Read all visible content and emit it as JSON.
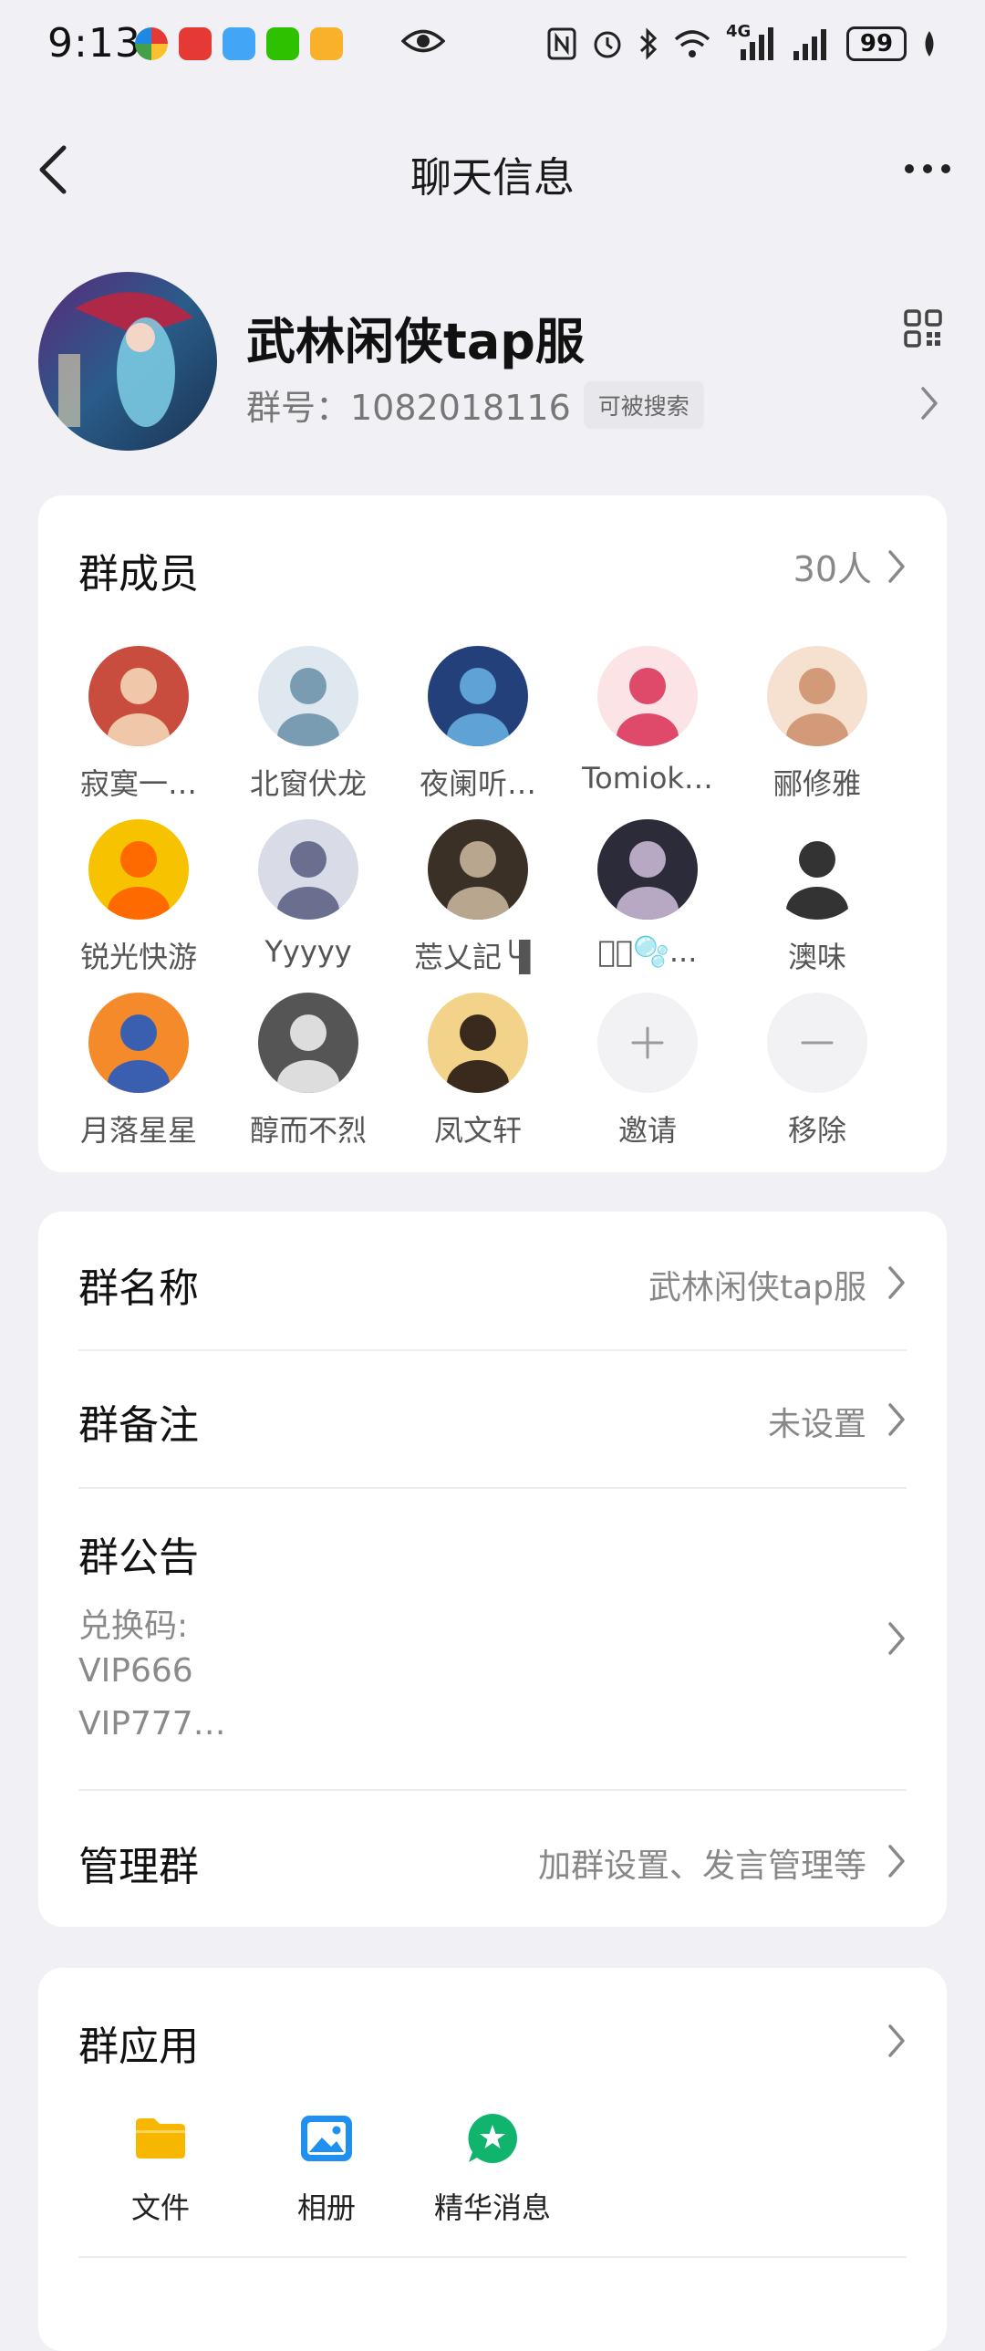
{
  "status_bar": {
    "time": "9:13",
    "network": "4G",
    "battery": "99"
  },
  "nav": {
    "title": "聊天信息"
  },
  "group": {
    "name": "武林闲侠tap服",
    "id_text": "群号：1082018116",
    "searchable_badge": "可被搜索"
  },
  "members": {
    "title": "群成员",
    "count": "30人",
    "items": [
      {
        "name": "寂寞一…"
      },
      {
        "name": "北窗伏龙"
      },
      {
        "name": "夜阑听…"
      },
      {
        "name": "Tomiok…"
      },
      {
        "name": "郦修雅"
      },
      {
        "name": "锐光快游"
      },
      {
        "name": "Yyyyy"
      },
      {
        "name": "莣乂記╰▌"
      },
      {
        "name": "ᡃ⃝🫧..."
      },
      {
        "name": "澳味"
      },
      {
        "name": "月落星星"
      },
      {
        "name": "醇而不烈"
      },
      {
        "name": "凤文轩"
      }
    ],
    "invite_label": "邀请",
    "remove_label": "移除"
  },
  "info": {
    "group_name_label": "群名称",
    "group_name_value": "武林闲侠tap服",
    "remark_label": "群备注",
    "remark_value": "未设置",
    "notice_label": "群公告",
    "notice_lines": [
      "兑换码:",
      "VIP666",
      "VIP777…"
    ],
    "manage_label": "管理群",
    "manage_value": "加群设置、发言管理等"
  },
  "apps": {
    "title": "群应用",
    "items": [
      {
        "label": "文件",
        "icon": "folder-icon",
        "color": "#f7b600"
      },
      {
        "label": "相册",
        "icon": "photo-icon",
        "color": "#1f8ff0"
      },
      {
        "label": "精华消息",
        "icon": "star-chat-icon",
        "color": "#10b46c"
      }
    ]
  },
  "colors": {
    "background": "#f1f1f5",
    "card": "#ffffff",
    "secondary_text": "#888888"
  }
}
